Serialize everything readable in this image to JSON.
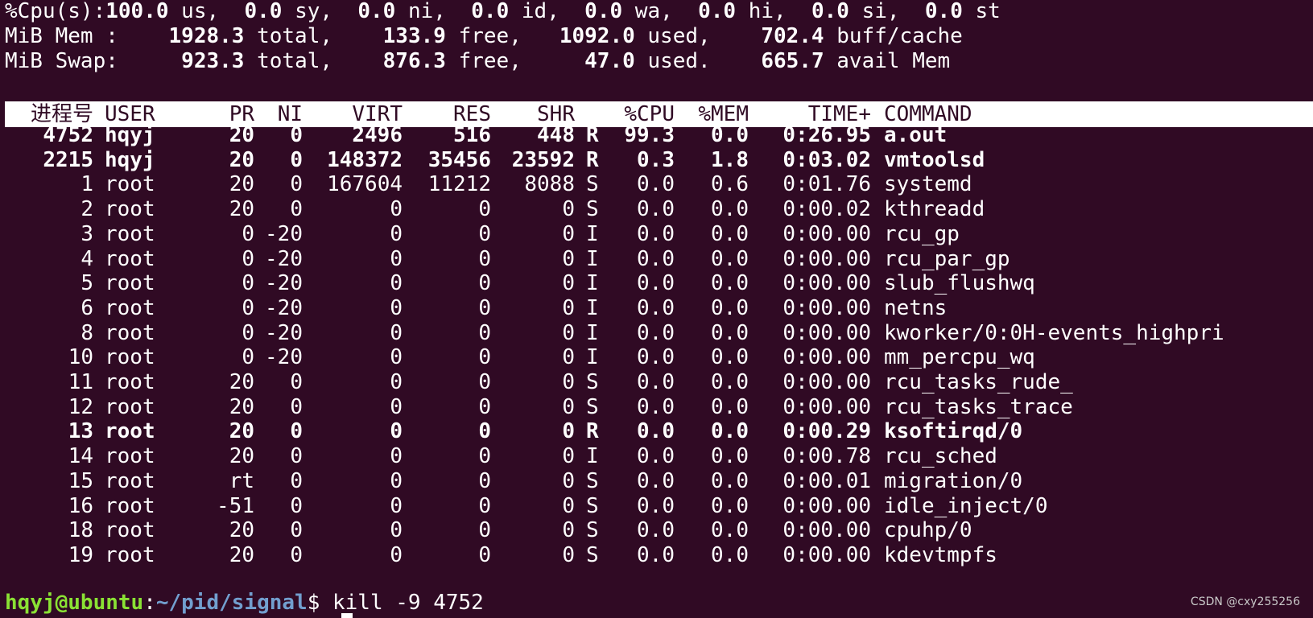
{
  "summary": {
    "cpu": [
      {
        "label": "%Cpu(s):",
        "value": "100.0",
        "unit": " us, "
      },
      {
        "label": "",
        "value": "0.0",
        "unit": " sy, "
      },
      {
        "label": "",
        "value": "0.0",
        "unit": " ni, "
      },
      {
        "label": "",
        "value": "0.0",
        "unit": " id, "
      },
      {
        "label": "",
        "value": "0.0",
        "unit": " wa, "
      },
      {
        "label": "",
        "value": "0.0",
        "unit": " hi, "
      },
      {
        "label": "",
        "value": "0.0",
        "unit": " si, "
      },
      {
        "label": "",
        "value": "0.0",
        "unit": " st"
      }
    ],
    "mem": {
      "label": "MiB Mem :",
      "total": "1928.3",
      "total_label": "total,",
      "free": "133.9",
      "free_label": "free,",
      "used": "1092.0",
      "used_label": "used,",
      "cache": "702.4",
      "cache_label": "buff/cache"
    },
    "swap": {
      "label": "MiB Swap:",
      "total": "923.3",
      "total_label": "total,",
      "free": "876.3",
      "free_label": "free,",
      "used": "47.0",
      "used_label": "used.",
      "avail": "665.7",
      "avail_label": "avail Mem"
    }
  },
  "table": {
    "headers": {
      "pid": "进程号",
      "user": "USER",
      "pr": "PR",
      "ni": "NI",
      "virt": "VIRT",
      "res": "RES",
      "shr": "SHR",
      "s": "",
      "cpu": "%CPU",
      "mem": "%MEM",
      "time": "TIME+",
      "command": "COMMAND"
    },
    "rows": [
      {
        "bold": true,
        "pid": "4752",
        "user": "hqyj",
        "pr": "20",
        "ni": "0",
        "virt": "2496",
        "res": "516",
        "shr": "448",
        "s": "R",
        "cpu": "99.3",
        "mem": "0.0",
        "time": "0:26.95",
        "command": "a.out"
      },
      {
        "bold": true,
        "pid": "2215",
        "user": "hqyj",
        "pr": "20",
        "ni": "0",
        "virt": "148372",
        "res": "35456",
        "shr": "23592",
        "s": "R",
        "cpu": "0.3",
        "mem": "1.8",
        "time": "0:03.02",
        "command": "vmtoolsd"
      },
      {
        "bold": false,
        "pid": "1",
        "user": "root",
        "pr": "20",
        "ni": "0",
        "virt": "167604",
        "res": "11212",
        "shr": "8088",
        "s": "S",
        "cpu": "0.0",
        "mem": "0.6",
        "time": "0:01.76",
        "command": "systemd"
      },
      {
        "bold": false,
        "pid": "2",
        "user": "root",
        "pr": "20",
        "ni": "0",
        "virt": "0",
        "res": "0",
        "shr": "0",
        "s": "S",
        "cpu": "0.0",
        "mem": "0.0",
        "time": "0:00.02",
        "command": "kthreadd"
      },
      {
        "bold": false,
        "pid": "3",
        "user": "root",
        "pr": "0",
        "ni": "-20",
        "virt": "0",
        "res": "0",
        "shr": "0",
        "s": "I",
        "cpu": "0.0",
        "mem": "0.0",
        "time": "0:00.00",
        "command": "rcu_gp"
      },
      {
        "bold": false,
        "pid": "4",
        "user": "root",
        "pr": "0",
        "ni": "-20",
        "virt": "0",
        "res": "0",
        "shr": "0",
        "s": "I",
        "cpu": "0.0",
        "mem": "0.0",
        "time": "0:00.00",
        "command": "rcu_par_gp"
      },
      {
        "bold": false,
        "pid": "5",
        "user": "root",
        "pr": "0",
        "ni": "-20",
        "virt": "0",
        "res": "0",
        "shr": "0",
        "s": "I",
        "cpu": "0.0",
        "mem": "0.0",
        "time": "0:00.00",
        "command": "slub_flushwq"
      },
      {
        "bold": false,
        "pid": "6",
        "user": "root",
        "pr": "0",
        "ni": "-20",
        "virt": "0",
        "res": "0",
        "shr": "0",
        "s": "I",
        "cpu": "0.0",
        "mem": "0.0",
        "time": "0:00.00",
        "command": "netns"
      },
      {
        "bold": false,
        "pid": "8",
        "user": "root",
        "pr": "0",
        "ni": "-20",
        "virt": "0",
        "res": "0",
        "shr": "0",
        "s": "I",
        "cpu": "0.0",
        "mem": "0.0",
        "time": "0:00.00",
        "command": "kworker/0:0H-events_highpri"
      },
      {
        "bold": false,
        "pid": "10",
        "user": "root",
        "pr": "0",
        "ni": "-20",
        "virt": "0",
        "res": "0",
        "shr": "0",
        "s": "I",
        "cpu": "0.0",
        "mem": "0.0",
        "time": "0:00.00",
        "command": "mm_percpu_wq"
      },
      {
        "bold": false,
        "pid": "11",
        "user": "root",
        "pr": "20",
        "ni": "0",
        "virt": "0",
        "res": "0",
        "shr": "0",
        "s": "S",
        "cpu": "0.0",
        "mem": "0.0",
        "time": "0:00.00",
        "command": "rcu_tasks_rude_"
      },
      {
        "bold": false,
        "pid": "12",
        "user": "root",
        "pr": "20",
        "ni": "0",
        "virt": "0",
        "res": "0",
        "shr": "0",
        "s": "S",
        "cpu": "0.0",
        "mem": "0.0",
        "time": "0:00.00",
        "command": "rcu_tasks_trace"
      },
      {
        "bold": true,
        "pid": "13",
        "user": "root",
        "pr": "20",
        "ni": "0",
        "virt": "0",
        "res": "0",
        "shr": "0",
        "s": "R",
        "cpu": "0.0",
        "mem": "0.0",
        "time": "0:00.29",
        "command": "ksoftirqd/0"
      },
      {
        "bold": false,
        "pid": "14",
        "user": "root",
        "pr": "20",
        "ni": "0",
        "virt": "0",
        "res": "0",
        "shr": "0",
        "s": "I",
        "cpu": "0.0",
        "mem": "0.0",
        "time": "0:00.78",
        "command": "rcu_sched"
      },
      {
        "bold": false,
        "pid": "15",
        "user": "root",
        "pr": "rt",
        "ni": "0",
        "virt": "0",
        "res": "0",
        "shr": "0",
        "s": "S",
        "cpu": "0.0",
        "mem": "0.0",
        "time": "0:00.01",
        "command": "migration/0"
      },
      {
        "bold": false,
        "pid": "16",
        "user": "root",
        "pr": "-51",
        "ni": "0",
        "virt": "0",
        "res": "0",
        "shr": "0",
        "s": "S",
        "cpu": "0.0",
        "mem": "0.0",
        "time": "0:00.00",
        "command": "idle_inject/0"
      },
      {
        "bold": false,
        "pid": "18",
        "user": "root",
        "pr": "20",
        "ni": "0",
        "virt": "0",
        "res": "0",
        "shr": "0",
        "s": "S",
        "cpu": "0.0",
        "mem": "0.0",
        "time": "0:00.00",
        "command": "cpuhp/0"
      },
      {
        "bold": false,
        "pid": "19",
        "user": "root",
        "pr": "20",
        "ni": "0",
        "virt": "0",
        "res": "0",
        "shr": "0",
        "s": "S",
        "cpu": "0.0",
        "mem": "0.0",
        "time": "0:00.00",
        "command": "kdevtmpfs"
      }
    ]
  },
  "prompt": {
    "user_host": "hqyj@ubuntu",
    "sep": ":",
    "path": "~/pid/signal",
    "symbol": "$",
    "command": " kill -9 4752"
  },
  "watermark": "CSDN @cxy255256",
  "colors": {
    "background": "#300a24",
    "text": "#ffffff",
    "prompt_user": "#8ae234",
    "prompt_path": "#729fcf",
    "header_bg": "#ffffff"
  }
}
